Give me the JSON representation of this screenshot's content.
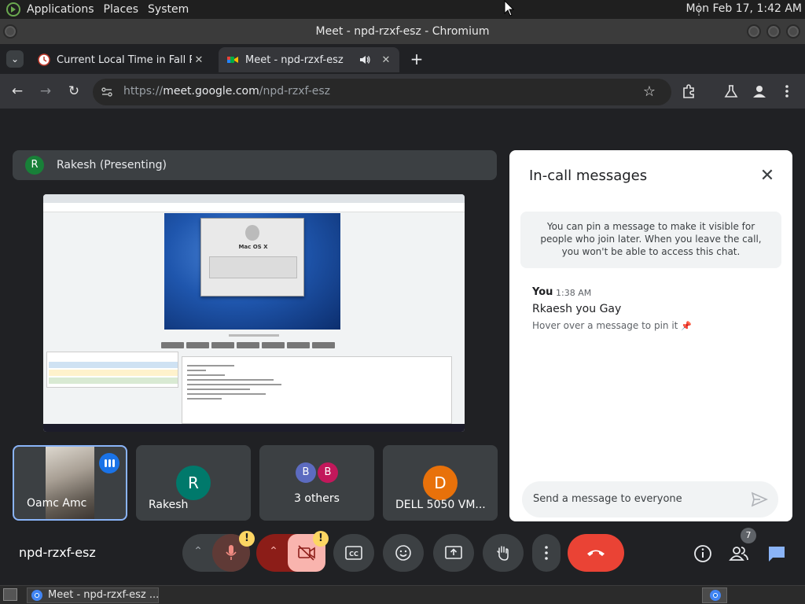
{
  "top_panel": {
    "menus": [
      "Applications",
      "Places",
      "System"
    ],
    "clock": "Mon Feb 17,  1:42 AM"
  },
  "window": {
    "title": "Meet - npd-rzxf-esz - Chromium"
  },
  "tabs": [
    {
      "label": "Current Local Time in Fall River",
      "icon": "clock-favicon",
      "close": "✕"
    },
    {
      "label": "Meet - npd-rzxf-esz",
      "icon": "meet-favicon",
      "close": "✕",
      "audio_icon": "speaker-icon"
    }
  ],
  "new_tab_label": "+",
  "toolbar": {
    "url_scheme": "https://",
    "url_host": "meet.google.com",
    "url_path": "/npd-rzxf-esz"
  },
  "meet": {
    "presenter": {
      "initial": "R",
      "label": "Rakesh (Presenting)",
      "avatar_color": "#188038"
    },
    "shared_screen": {
      "dialog_title": "Mac OS X"
    },
    "tiles": [
      {
        "name": "Oamc Amc",
        "type": "video"
      },
      {
        "name": "Rakesh",
        "initial": "R",
        "avatar_color": "#00796b"
      },
      {
        "name": "3 others",
        "initials": [
          "B",
          "B"
        ],
        "avatar_colors": [
          "#5c6bc0",
          "#c2185b"
        ]
      },
      {
        "name": "DELL 5050 VM...",
        "initial": "D",
        "avatar_color": "#e8710a"
      }
    ],
    "chat": {
      "title": "In-call messages",
      "pin_info": "You can pin a message to make it visible for people who join later. When you leave the call, you won't be able to access this chat.",
      "messages": [
        {
          "sender": "You",
          "time": "1:38 AM",
          "text": "Rkaesh you Gay",
          "hint": "Hover over a message to pin it"
        }
      ],
      "input_placeholder": "Send a message to everyone"
    },
    "meeting_code": "npd-rzxf-esz",
    "controls": {
      "mic_warning": "!",
      "cam_warning": "!",
      "people_count": "7"
    },
    "colors": {
      "end_call": "#ea4335",
      "muted_bg": "#8c1d18",
      "accent": "#8ab4f8"
    }
  },
  "taskbar": {
    "window_label": "Meet - npd-rzxf-esz ..."
  }
}
